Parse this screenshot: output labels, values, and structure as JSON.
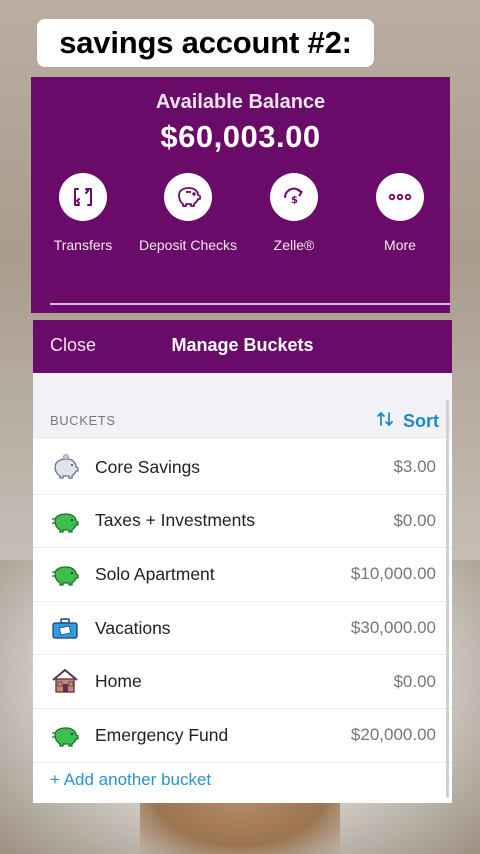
{
  "caption": "savings account #2:",
  "account": {
    "balance_title": "Available Balance",
    "balance_amount": "$60,003.00",
    "actions": [
      {
        "label": "Transfers",
        "icon": "transfer-icon"
      },
      {
        "label": "Deposit Checks",
        "icon": "piggy-bank-icon"
      },
      {
        "label": "Zelle®",
        "icon": "zelle-icon"
      },
      {
        "label": "More",
        "icon": "more-dots-icon"
      }
    ]
  },
  "sheet": {
    "close_label": "Close",
    "title": "Manage Buckets",
    "section_label": "BUCKETS",
    "sort_label": "Sort",
    "buckets": [
      {
        "name": "Core Savings",
        "amount": "$3.00",
        "icon": "piggy-bank-icon"
      },
      {
        "name": "Taxes + Investments",
        "amount": "$0.00",
        "icon": "green-piggy-icon"
      },
      {
        "name": "Solo Apartment",
        "amount": "$10,000.00",
        "icon": "green-piggy-icon"
      },
      {
        "name": "Vacations",
        "amount": "$30,000.00",
        "icon": "suitcase-icon"
      },
      {
        "name": "Home",
        "amount": "$0.00",
        "icon": "house-icon"
      },
      {
        "name": "Emergency Fund",
        "amount": "$20,000.00",
        "icon": "green-piggy-icon"
      }
    ],
    "add_label": "+ Add another bucket"
  },
  "colors": {
    "brand_purple": "#6b0b69",
    "link_blue": "#1a8bc9",
    "amount_gray": "#777777"
  }
}
